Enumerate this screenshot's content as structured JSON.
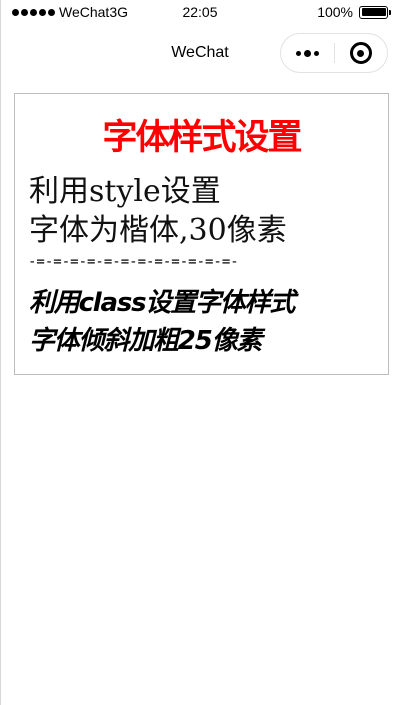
{
  "status_bar": {
    "carrier": "WeChat3G",
    "time": "22:05",
    "battery": "100%",
    "battery_level": 1.0
  },
  "nav": {
    "title": "WeChat"
  },
  "content": {
    "title": "字体样式设置",
    "kai_lines": [
      "利用style设置",
      "字体为楷体,30像素"
    ],
    "divider": "-=-=-=-=-=-=-=-=-=-=-=-=-",
    "class_lines": [
      "利用class设置字体样式",
      "字体倾斜加粗25像素"
    ]
  },
  "colors": {
    "title": "#ff0000",
    "text": "#000000",
    "border": "#bdbdbd"
  },
  "icons": {
    "more": "more-dots-icon",
    "close": "target-circle-icon"
  }
}
